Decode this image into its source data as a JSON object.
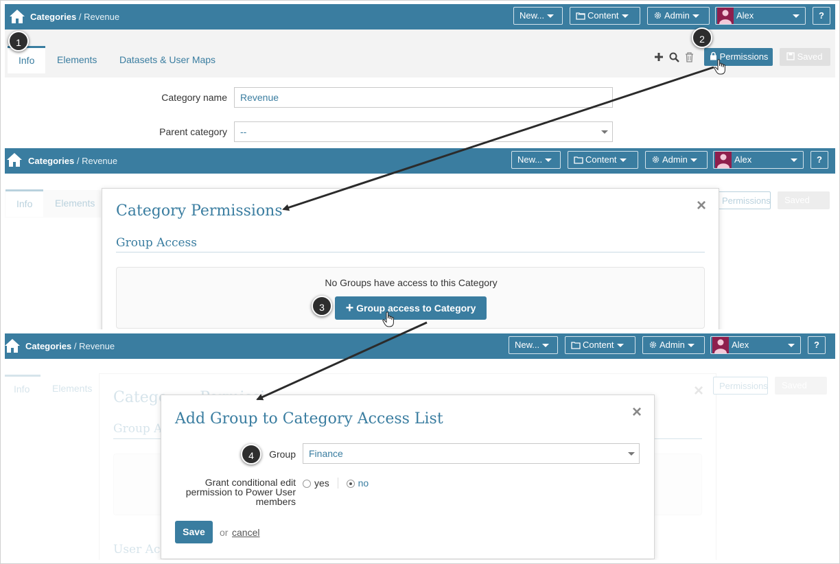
{
  "topbar": {
    "breadcrumb_parent": "Categories",
    "breadcrumb_sep": "/",
    "breadcrumb_current": "Revenue",
    "new_label": "New...",
    "content_label": "Content",
    "admin_label": "Admin",
    "user_name": "Alex",
    "help_label": "?"
  },
  "tabs": [
    "Info",
    "Elements",
    "Datasets & User Maps"
  ],
  "toolbar": {
    "permissions_label": "Permissions",
    "saved_label": "Saved"
  },
  "form": {
    "category_name_label": "Category name",
    "category_name_value": "Revenue",
    "parent_category_label": "Parent category",
    "parent_category_value": "--"
  },
  "perm_modal": {
    "title": "Category Permissions",
    "group_access_title": "Group Access",
    "no_groups_text": "No Groups have access to this Category",
    "add_group_button": "Group access to Category",
    "plus": "+"
  },
  "add_modal": {
    "title": "Add Group to Category Access List",
    "group_label": "Group",
    "group_value": "Finance",
    "grant_label_line1": "Grant conditional edit",
    "grant_label_line2": "permission to Power User",
    "grant_label_line3": "members",
    "yes_label": "yes",
    "no_label": "no",
    "save_label": "Save",
    "or_text": "or",
    "cancel_label": "cancel"
  },
  "background_fragments": {
    "category_title_partial": "Catego",
    "category_title_partial2": "Permissi",
    "group_access_partial": "Group A",
    "user_access_partial": "User Acc"
  },
  "steps": [
    "1",
    "2",
    "3",
    "4"
  ],
  "colors": {
    "brand": "#3a7da0",
    "avatar": "#8e1f4d",
    "badge": "#2e2e2e"
  }
}
